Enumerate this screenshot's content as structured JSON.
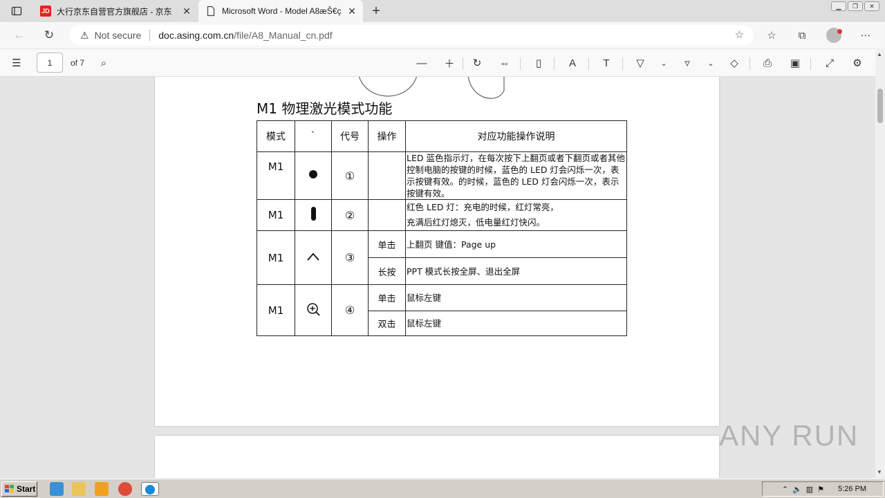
{
  "browser": {
    "tabs": [
      {
        "title": "大行京东自营官方旗舰店 - 京东",
        "favicon": "JD",
        "active": false
      },
      {
        "title": "Microsoft Word - Model A8æŠ€ç",
        "active": true
      }
    ],
    "address": {
      "security_label": "Not secure",
      "host": "doc.asing.com.cn",
      "path": "/file/A8_Manual_cn.pdf"
    }
  },
  "pdf_toolbar": {
    "page_value": "1",
    "page_total_label": "of 7"
  },
  "document": {
    "heading": "M1 物理激光模式功能",
    "table": {
      "headers": [
        "模式",
        "`",
        "代号",
        "操作",
        "对应功能操作说明"
      ],
      "rows": [
        {
          "mode": "M1",
          "icon": "dot-icon",
          "code": "①",
          "op": "",
          "desc": "LED 蓝色指示灯，在每次按下上翻页或者下翻页或者其他控制电脑的按键的时候，蓝色的 LED 灯会闪烁一次，表示按键有效。的时候，蓝色的 LED 灯会闪烁一次，表示按键有效。"
        },
        {
          "mode": "M1",
          "icon": "pill-icon",
          "code": "②",
          "op": "",
          "desc1": "红色 LED 灯：充电的时候，红灯常亮，",
          "desc2": "充满后红灯熄灭，低电量红灯快闪。"
        },
        {
          "mode": "M1",
          "icon": "chevron-up-icon",
          "code": "③",
          "sub": [
            {
              "op": "单击",
              "desc": "上翻页    键值：Page up"
            },
            {
              "op": "长按",
              "desc": "PPT 模式长按全屏、退出全屏"
            }
          ]
        },
        {
          "mode": "M1",
          "icon": "zoom-in-icon",
          "code": "④",
          "sub": [
            {
              "op": "单击",
              "desc": "鼠标左键"
            },
            {
              "op": "双击",
              "desc": "鼠标左键"
            }
          ]
        }
      ]
    }
  },
  "watermark": "ANY RUN",
  "taskbar": {
    "start_label": "Start",
    "clock": "5:26 PM"
  }
}
